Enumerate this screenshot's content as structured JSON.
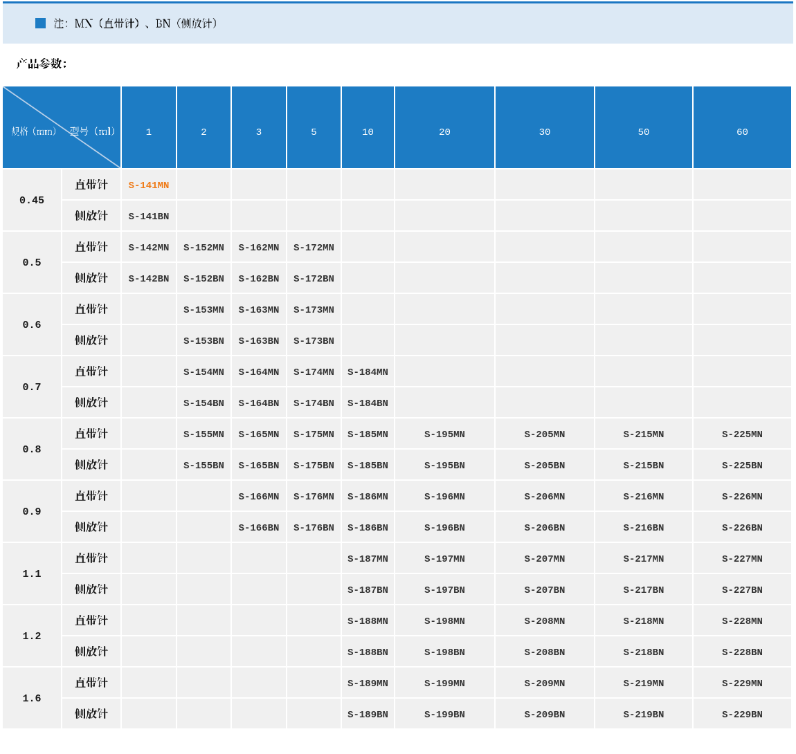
{
  "note": {
    "bullet_icon": "blue-square",
    "text": "注：MN（直带针）、BN（侧放针）"
  },
  "heading": {
    "text": "产品参数："
  },
  "table": {
    "corner": {
      "spec_label": "规格（mm）",
      "model_label": "型号（ml）"
    },
    "columns": [
      "1",
      "2",
      "3",
      "5",
      "10",
      "20",
      "30",
      "50",
      "60"
    ],
    "row_labels": {
      "mn": "直带针",
      "bn": "侧放针"
    },
    "groups": [
      {
        "spec": "0.45",
        "mn": [
          "S-141MN",
          "",
          "",
          "",
          "",
          "",
          "",
          "",
          ""
        ],
        "bn": [
          "S-141BN",
          "",
          "",
          "",
          "",
          "",
          "",
          "",
          ""
        ]
      },
      {
        "spec": "0.5",
        "mn": [
          "S-142MN",
          "S-152MN",
          "S-162MN",
          "S-172MN",
          "",
          "",
          "",
          "",
          ""
        ],
        "bn": [
          "S-142BN",
          "S-152BN",
          "S-162BN",
          "S-172BN",
          "",
          "",
          "",
          "",
          ""
        ]
      },
      {
        "spec": "0.6",
        "mn": [
          "",
          "S-153MN",
          "S-163MN",
          "S-173MN",
          "",
          "",
          "",
          "",
          ""
        ],
        "bn": [
          "",
          "S-153BN",
          "S-163BN",
          "S-173BN",
          "",
          "",
          "",
          "",
          ""
        ]
      },
      {
        "spec": "0.7",
        "mn": [
          "",
          "S-154MN",
          "S-164MN",
          "S-174MN",
          "S-184MN",
          "",
          "",
          "",
          ""
        ],
        "bn": [
          "",
          "S-154BN",
          "S-164BN",
          "S-174BN",
          "S-184BN",
          "",
          "",
          "",
          ""
        ]
      },
      {
        "spec": "0.8",
        "mn": [
          "",
          "S-155MN",
          "S-165MN",
          "S-175MN",
          "S-185MN",
          "S-195MN",
          "S-205MN",
          "S-215MN",
          "S-225MN"
        ],
        "bn": [
          "",
          "S-155BN",
          "S-165BN",
          "S-175BN",
          "S-185BN",
          "S-195BN",
          "S-205BN",
          "S-215BN",
          "S-225BN"
        ]
      },
      {
        "spec": "0.9",
        "mn": [
          "",
          "",
          "S-166MN",
          "S-176MN",
          "S-186MN",
          "S-196MN",
          "S-206MN",
          "S-216MN",
          "S-226MN"
        ],
        "bn": [
          "",
          "",
          "S-166BN",
          "S-176BN",
          "S-186BN",
          "S-196BN",
          "S-206BN",
          "S-216BN",
          "S-226BN"
        ]
      },
      {
        "spec": "1.1",
        "mn": [
          "",
          "",
          "",
          "",
          "S-187MN",
          "S-197MN",
          "S-207MN",
          "S-217MN",
          "S-227MN"
        ],
        "bn": [
          "",
          "",
          "",
          "",
          "S-187BN",
          "S-197BN",
          "S-207BN",
          "S-217BN",
          "S-227BN"
        ]
      },
      {
        "spec": "1.2",
        "mn": [
          "",
          "",
          "",
          "",
          "S-188MN",
          "S-198MN",
          "S-208MN",
          "S-218MN",
          "S-228MN"
        ],
        "bn": [
          "",
          "",
          "",
          "",
          "S-188BN",
          "S-198BN",
          "S-208BN",
          "S-218BN",
          "S-228BN"
        ]
      },
      {
        "spec": "1.6",
        "mn": [
          "",
          "",
          "",
          "",
          "S-189MN",
          "S-199MN",
          "S-209MN",
          "S-219MN",
          "S-229MN"
        ],
        "bn": [
          "",
          "",
          "",
          "",
          "S-189BN",
          "S-199BN",
          "S-209BN",
          "S-219BN",
          "S-229BN"
        ]
      }
    ],
    "highlight": {
      "value": "S-141MN",
      "row_spec": "0.45",
      "row_type": "直带针",
      "column": "1",
      "color": "#ef7a16"
    }
  },
  "colors": {
    "accent_blue": "#1d7cc4",
    "banner_top_line": "#1a76c2",
    "banner_bg": "#dce9f5",
    "cell_bg": "#f0f0f0",
    "grid_line": "#ffffff",
    "header_text": "#ffffff",
    "model_text": "#333333",
    "label_text": "#1a1a1a",
    "highlight_text": "#ef7a16",
    "page_bg": "#ffffff"
  }
}
